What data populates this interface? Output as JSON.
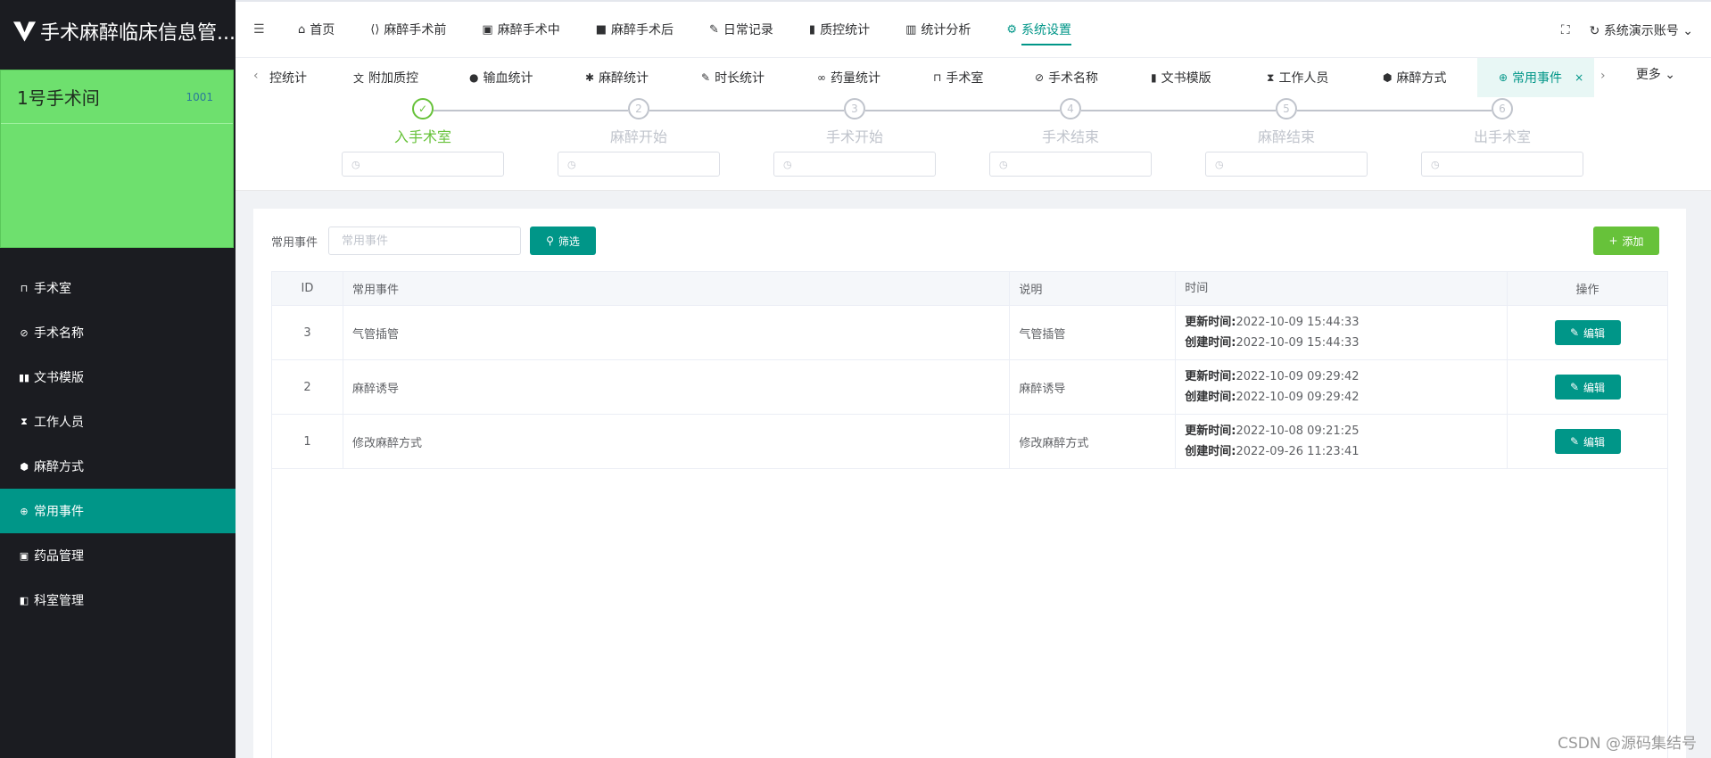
{
  "app": {
    "title": "手术麻醉临床信息管..."
  },
  "room": {
    "name": "1号手术间",
    "code": "1001"
  },
  "sidebar": {
    "items": [
      {
        "label": "手术室",
        "icon": "room-icon"
      },
      {
        "label": "手术名称",
        "icon": "no-icon"
      },
      {
        "label": "文书模版",
        "icon": "book-icon"
      },
      {
        "label": "工作人员",
        "icon": "hourglass-icon"
      },
      {
        "label": "麻醉方式",
        "icon": "angular-icon"
      },
      {
        "label": "常用事件",
        "icon": "plus-circle-icon",
        "active": true
      },
      {
        "label": "药品管理",
        "icon": "file-plus-icon"
      },
      {
        "label": "科室管理",
        "icon": "switch-icon"
      }
    ]
  },
  "topnav": {
    "items": [
      {
        "label": "首页",
        "icon": "home-icon"
      },
      {
        "label": "麻醉手术前",
        "icon": "code-icon"
      },
      {
        "label": "麻醉手术中",
        "icon": "film-icon"
      },
      {
        "label": "麻醉手术后",
        "icon": "video-icon"
      },
      {
        "label": "日常记录",
        "icon": "pen-icon"
      },
      {
        "label": "质控统计",
        "icon": "bookmark-icon"
      },
      {
        "label": "统计分析",
        "icon": "bar-chart-icon"
      },
      {
        "label": "系统设置",
        "icon": "gear-icon",
        "active": true
      }
    ],
    "account": "系统演示账号"
  },
  "tabs": {
    "items": [
      {
        "label": "控统计",
        "icon": ""
      },
      {
        "label": "附加质控",
        "icon": "translate-icon"
      },
      {
        "label": "输血统计",
        "icon": "drop-icon"
      },
      {
        "label": "麻醉统计",
        "icon": "bug-icon"
      },
      {
        "label": "时长统计",
        "icon": "pen-icon"
      },
      {
        "label": "药量统计",
        "icon": "link-icon"
      },
      {
        "label": "手术室",
        "icon": "room-icon"
      },
      {
        "label": "手术名称",
        "icon": "no-icon"
      },
      {
        "label": "文书模版",
        "icon": "book-icon"
      },
      {
        "label": "工作人员",
        "icon": "hourglass-icon"
      },
      {
        "label": "麻醉方式",
        "icon": "angular-icon"
      },
      {
        "label": "常用事件",
        "icon": "plus-circle-icon",
        "active": true
      }
    ],
    "more_label": "更多"
  },
  "steps": [
    {
      "num": "✓",
      "title": "入手术室",
      "done": true
    },
    {
      "num": "2",
      "title": "麻醉开始"
    },
    {
      "num": "3",
      "title": "手术开始"
    },
    {
      "num": "4",
      "title": "手术结束"
    },
    {
      "num": "5",
      "title": "麻醉结束"
    },
    {
      "num": "6",
      "title": "出手术室"
    }
  ],
  "filter": {
    "label": "常用事件",
    "placeholder": "常用事件",
    "button": "筛选"
  },
  "add_button": "添加",
  "table": {
    "headers": {
      "id": "ID",
      "event": "常用事件",
      "desc": "说明",
      "time": "时间",
      "op": "操作"
    },
    "update_label": "更新时间:",
    "create_label": "创建时间:",
    "edit_label": "编辑",
    "rows": [
      {
        "id": "3",
        "event": "气管插管",
        "desc": "气管插管",
        "updated": "2022-10-09 15:44:33",
        "created": "2022-10-09 15:44:33"
      },
      {
        "id": "2",
        "event": "麻醉诱导",
        "desc": "麻醉诱导",
        "updated": "2022-10-09 09:29:42",
        "created": "2022-10-09 09:29:42"
      },
      {
        "id": "1",
        "event": "修改麻醉方式",
        "desc": "修改麻醉方式",
        "updated": "2022-10-08 09:21:25",
        "created": "2022-09-26 11:23:41"
      }
    ]
  },
  "watermark": "CSDN @源码集结号",
  "colors": {
    "primary": "#009688",
    "success": "#67c23a",
    "sidebar": "#1b1c21",
    "room_card": "#6ee06e"
  }
}
